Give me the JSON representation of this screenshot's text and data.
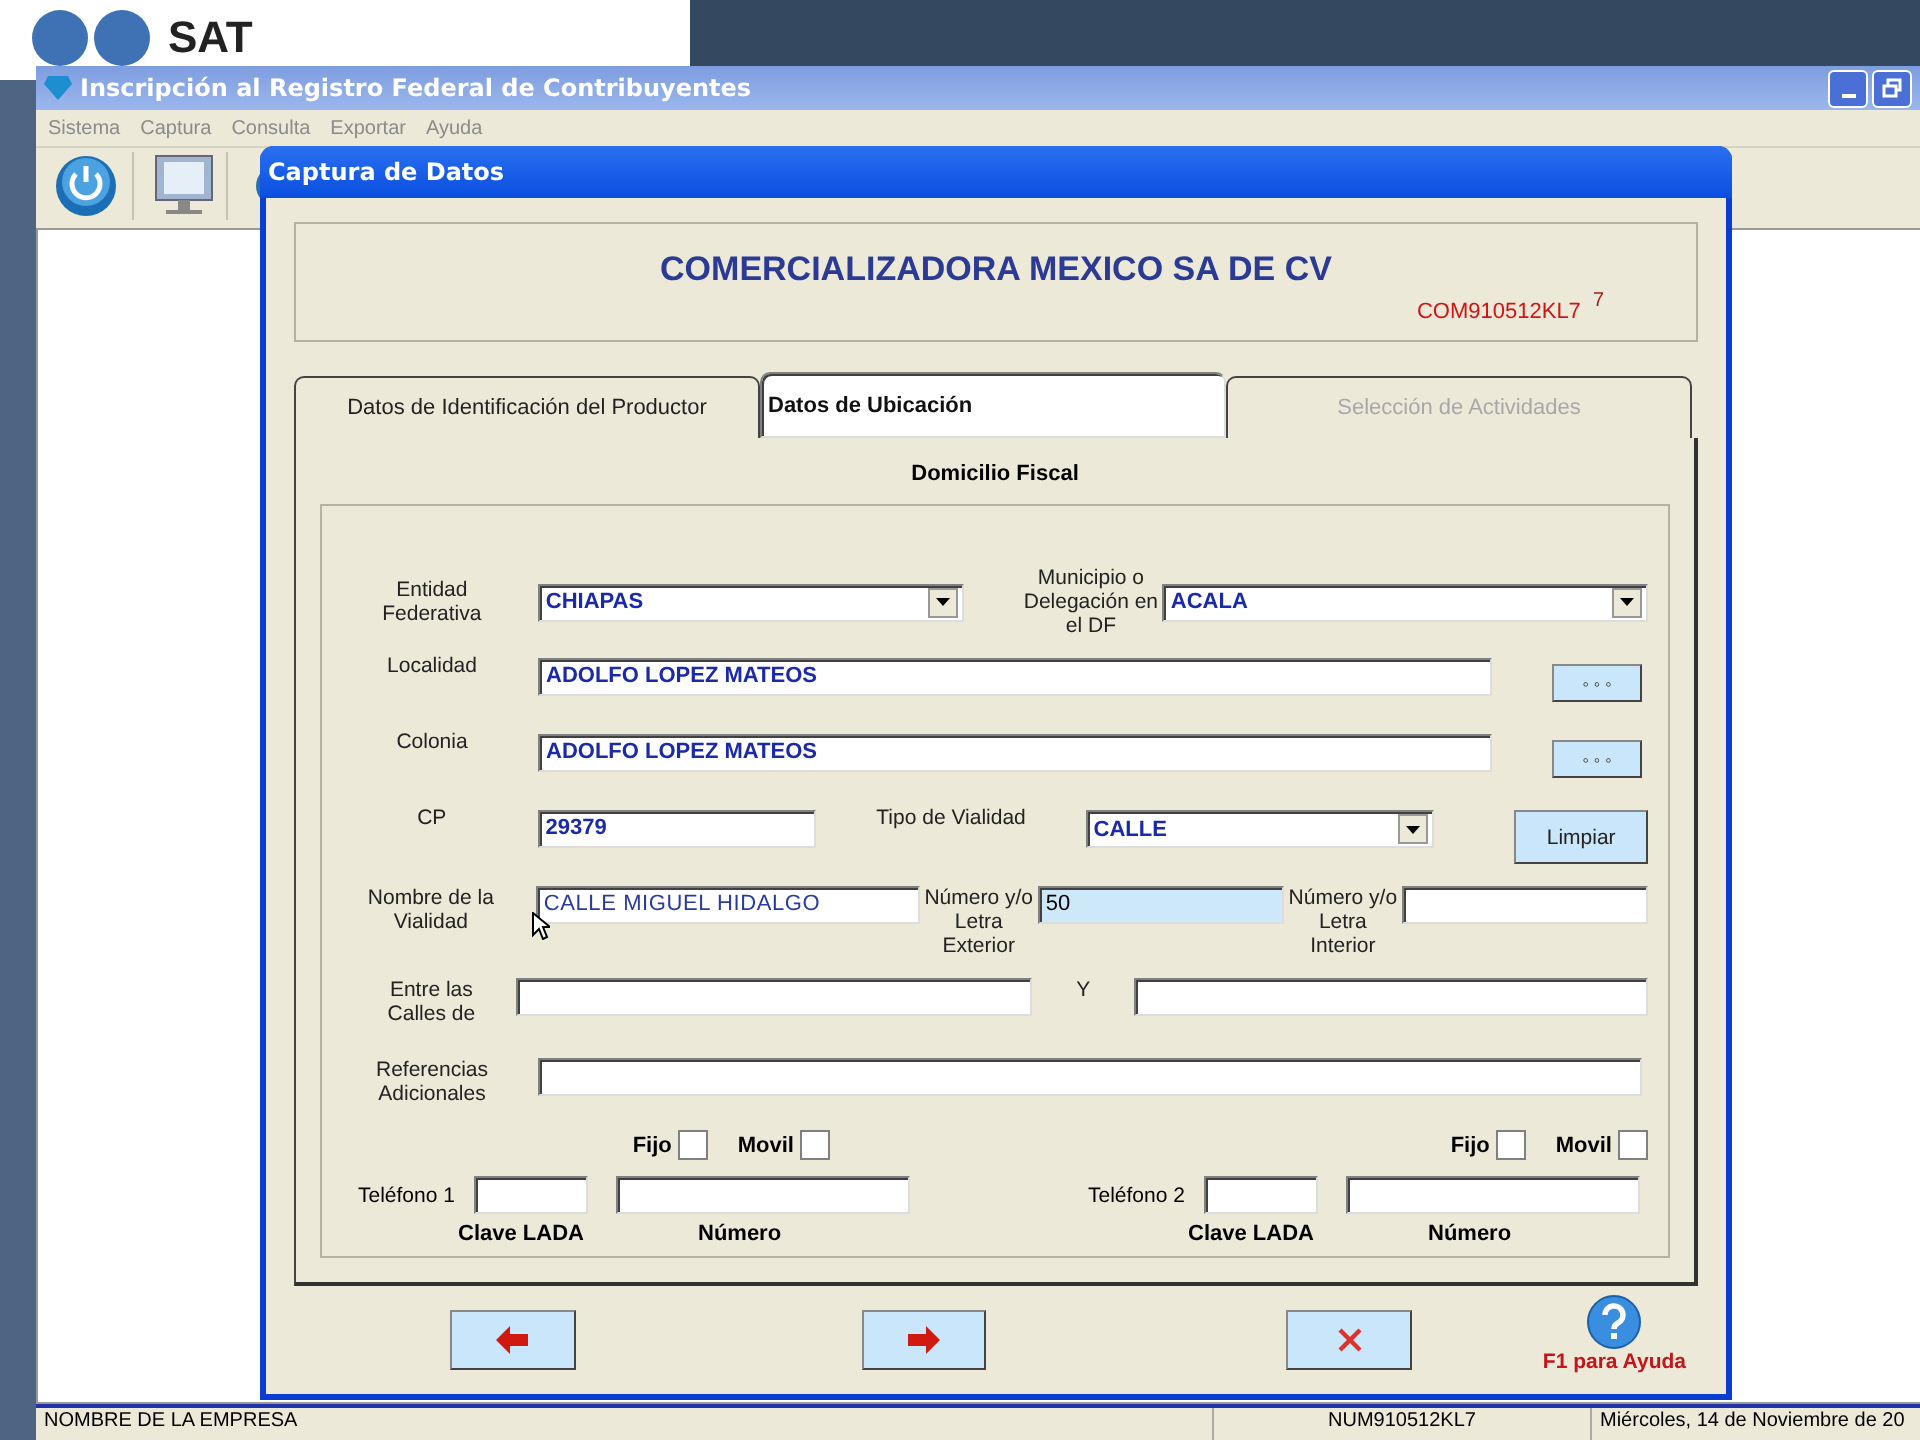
{
  "desktop": {
    "logo_text": "SAT"
  },
  "main_window": {
    "title": "Inscripción al Registro Federal de Contribuyentes",
    "menu": [
      "Sistema",
      "Captura",
      "Consulta",
      "Exportar",
      "Ayuda"
    ],
    "status_bar": [
      "NOMBRE DE LA EMPRESA",
      "NUM910512KL7",
      "Miércoles, 14 de Noviembre de 20"
    ]
  },
  "dialog": {
    "title": "Captura de Datos",
    "company_name": "COMERCIALIZADORA MEXICO SA DE CV",
    "rfc": "COM910512KL7",
    "rfc_mark": "7",
    "tabs": [
      {
        "label": "Datos de Identificación del Productor",
        "selected": false,
        "disabled": false
      },
      {
        "label": "Datos de Ubicación",
        "selected": true,
        "disabled": false
      },
      {
        "label": "Selección de Actividades",
        "selected": false,
        "disabled": true
      }
    ],
    "section_title": "Domicilio Fiscal",
    "entidad": {
      "label": "Entidad Federativa",
      "value": "CHIAPAS"
    },
    "municipio": {
      "label": "Municipio o Delegación en el DF",
      "value": "ACALA"
    },
    "localidad": {
      "label": "Localidad",
      "value": "ADOLFO LOPEZ MATEOS",
      "button": "◦ ◦ ◦"
    },
    "colonia": {
      "label": "Colonia",
      "value": "ADOLFO LOPEZ MATEOS",
      "button": "◦ ◦ ◦"
    },
    "cp": {
      "label": "CP",
      "value": "29379",
      "focused": false
    },
    "tipo_vialidad": {
      "label": "Tipo de Vialidad",
      "value": "CALLE"
    },
    "clear_button": "Limpiar",
    "nombre_vialidad": {
      "label": "Nombre de la Vialidad",
      "value": "CALLE MIGUEL HIDALGO",
      "focused": false
    },
    "numero_exterior": {
      "label": "Número y/o Letra Exterior",
      "value": "50",
      "focused": true
    },
    "numero_interior": {
      "label": "Número y/o Letra Interior",
      "focused": false
    },
    "entre_calles": {
      "label": "Entre las Calles de",
      "focused": false
    },
    "y_calle": {
      "label": "Y",
      "focused": false
    },
    "referencias": {
      "label": "Referencias Adicionales",
      "focused": false
    },
    "phones": [
      {
        "fijo": {
          "label": "Fijo",
          "checked": false
        },
        "movil": {
          "label": "Movil",
          "checked": false
        },
        "label": "Teléfono 1",
        "lada_label": "Clave LADA",
        "numero_label": "Número"
      },
      {
        "fijo": {
          "label": "Fijo",
          "checked": false
        },
        "movil": {
          "label": "Movil",
          "checked": false
        },
        "label": "Teléfono 2",
        "lada_label": "Clave LADA",
        "numero_label": "Número"
      }
    ],
    "help_text": "F1 para Ayuda"
  }
}
